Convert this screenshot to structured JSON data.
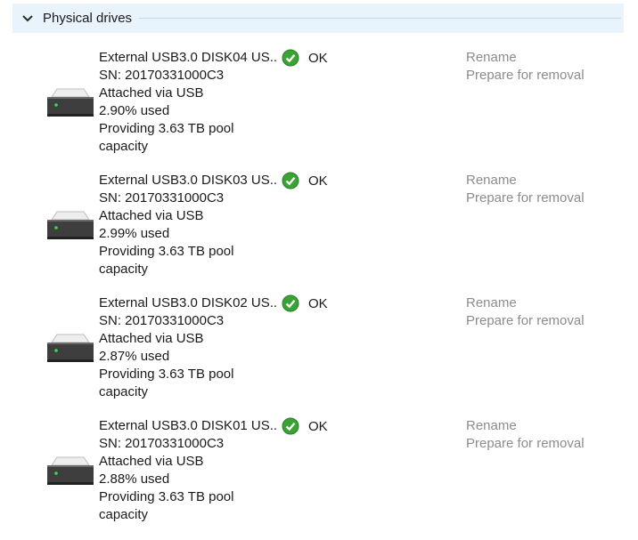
{
  "section": {
    "title": "Physical drives",
    "toggle_icon": "chevron-down-icon"
  },
  "drives": [
    {
      "name": "External USB3.0 DISK04 US...",
      "serial": "SN: 20170331000C3",
      "connection": "Attached via USB",
      "usage": "2.90% used",
      "providing": "Providing 3.63 TB pool",
      "providing_cont": "capacity",
      "status": "OK",
      "status_icon": "check-circle-icon",
      "rename_label": "Rename",
      "remove_label": "Prepare for removal"
    },
    {
      "name": "External USB3.0 DISK03 US...",
      "serial": "SN: 20170331000C3",
      "connection": "Attached via USB",
      "usage": "2.99% used",
      "providing": "Providing 3.63 TB pool",
      "providing_cont": "capacity",
      "status": "OK",
      "status_icon": "check-circle-icon",
      "rename_label": "Rename",
      "remove_label": "Prepare for removal"
    },
    {
      "name": "External USB3.0 DISK02 US...",
      "serial": "SN: 20170331000C3",
      "connection": "Attached via USB",
      "usage": "2.87% used",
      "providing": "Providing 3.63 TB pool",
      "providing_cont": "capacity",
      "status": "OK",
      "status_icon": "check-circle-icon",
      "rename_label": "Rename",
      "remove_label": "Prepare for removal"
    },
    {
      "name": "External USB3.0 DISK01 US...",
      "serial": "SN: 20170331000C3",
      "connection": "Attached via USB",
      "usage": "2.88% used",
      "providing": "Providing 3.63 TB pool",
      "providing_cont": "capacity",
      "status": "OK",
      "status_icon": "check-circle-icon",
      "rename_label": "Rename",
      "remove_label": "Prepare for removal"
    }
  ],
  "colors": {
    "header_bg": "#e9f3fc",
    "action_text": "#8c8c8c",
    "status_ok": "#3aa335"
  }
}
